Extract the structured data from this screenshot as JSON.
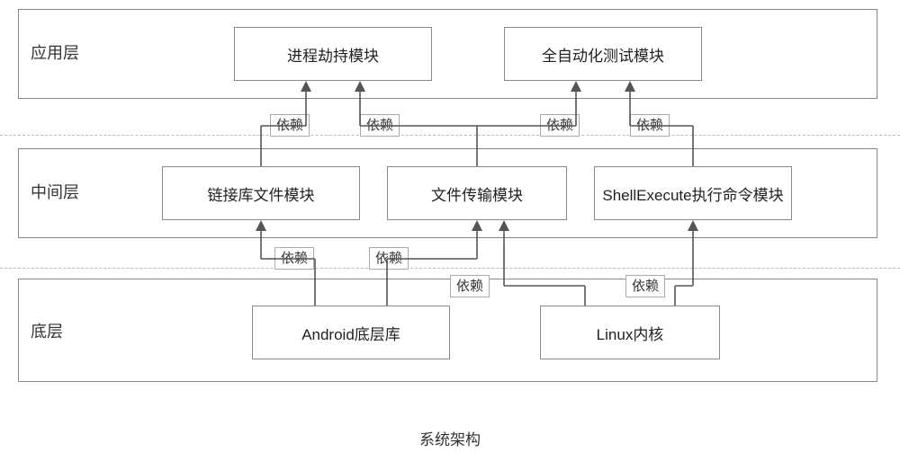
{
  "caption": "系统架构",
  "layers": {
    "app": {
      "label": "应用层",
      "boxes": {
        "hijack": "进程劫持模块",
        "autotest": "全自动化测试模块"
      }
    },
    "middle": {
      "label": "中间层",
      "boxes": {
        "linklib": "链接库文件模块",
        "filetrans": "文件传输模块",
        "shellexec": "ShellExecute执行命令模块"
      }
    },
    "bottom": {
      "label": "底层",
      "boxes": {
        "androidlib": "Android底层库",
        "linuxkernel": "Linux内核"
      }
    }
  },
  "dep_label": "依赖"
}
